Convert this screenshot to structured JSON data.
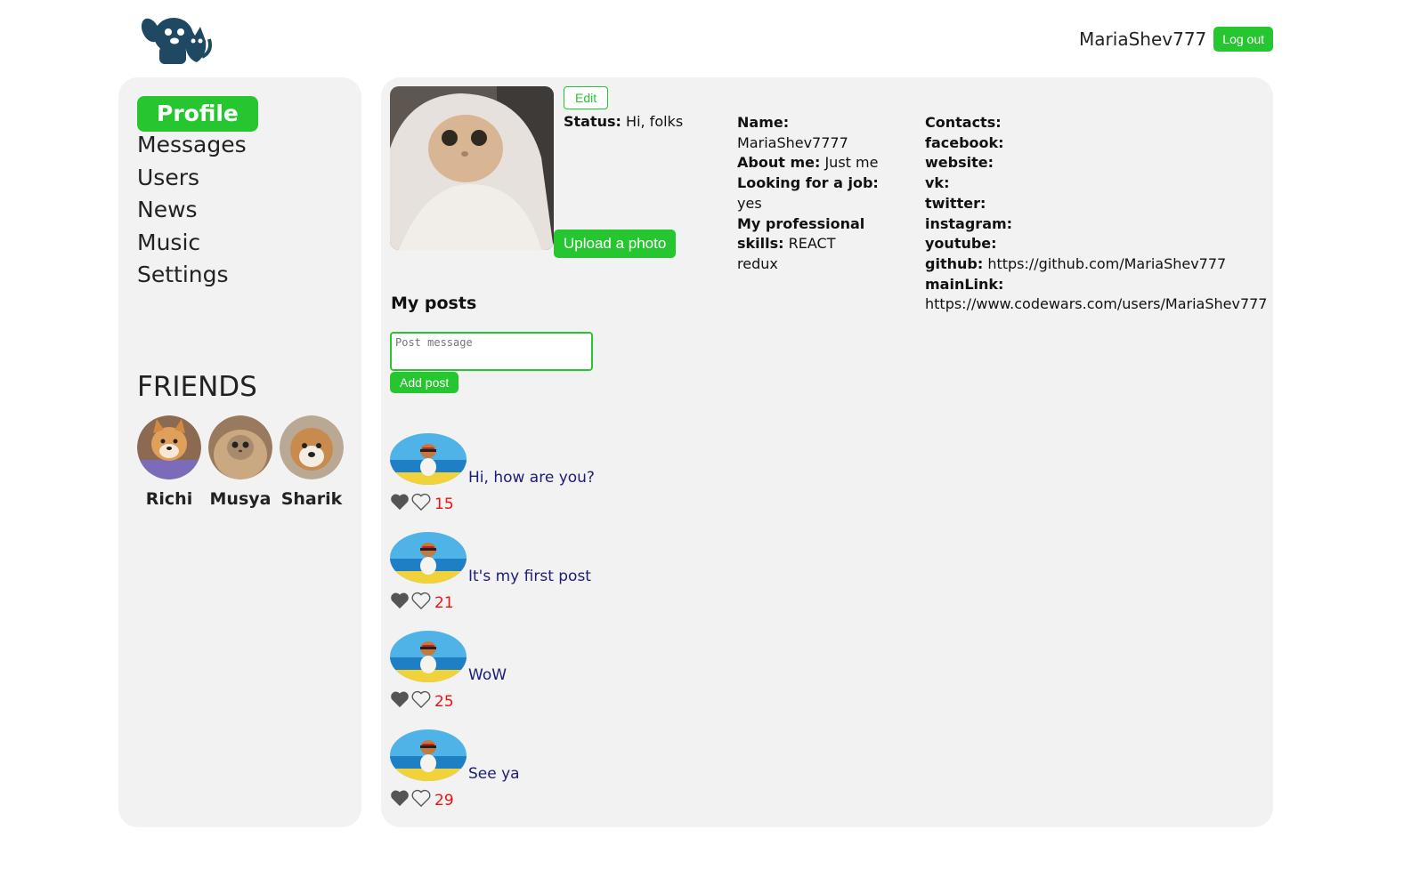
{
  "header": {
    "username": "MariaShev777",
    "logout_label": "Log out"
  },
  "nav": {
    "items": [
      {
        "label": "Profile",
        "active": true
      },
      {
        "label": "Messages"
      },
      {
        "label": "Users"
      },
      {
        "label": "News"
      },
      {
        "label": "Music"
      },
      {
        "label": "Settings"
      }
    ]
  },
  "friends": {
    "title": "FRIENDS",
    "list": [
      {
        "name": "Richi"
      },
      {
        "name": "Musya"
      },
      {
        "name": "Sharik"
      }
    ]
  },
  "profile": {
    "edit_label": "Edit",
    "status_label": "Status:",
    "status_value": "Hi, folks",
    "upload_label": "Upload a photo",
    "name_label": "Name:",
    "name_value": "MariaShev7777",
    "about_label": "About me:",
    "about_value": "Just me",
    "job_label": "Looking for a job:",
    "job_value": "yes",
    "skills_label_1": "My professional",
    "skills_label_2": "skills:",
    "skills_value": "REACT redux"
  },
  "contacts": {
    "title": "Contacts:",
    "facebook": "facebook:",
    "website": "website:",
    "vk": "vk:",
    "twitter": "twitter:",
    "instagram": "instagram:",
    "youtube": "youtube:",
    "github_label": "github:",
    "github_value": "https://github.com/MariaShev777",
    "mainlink_label": "mainLink:",
    "mainlink_value": "https://www.codewars.com/users/MariaShev777"
  },
  "posts": {
    "title": "My posts",
    "input_placeholder": "Post message",
    "add_label": "Add post",
    "items": [
      {
        "text": "Hi, how are you?",
        "likes": "15"
      },
      {
        "text": "It's my first post",
        "likes": "21"
      },
      {
        "text": "WoW",
        "likes": "25"
      },
      {
        "text": "See ya",
        "likes": "29"
      }
    ]
  },
  "colors": {
    "accent": "#25c630",
    "panel": "#f2f2f2",
    "post_text": "#1c1c7a",
    "likes": "#e11111",
    "logo": "#1f4963"
  }
}
